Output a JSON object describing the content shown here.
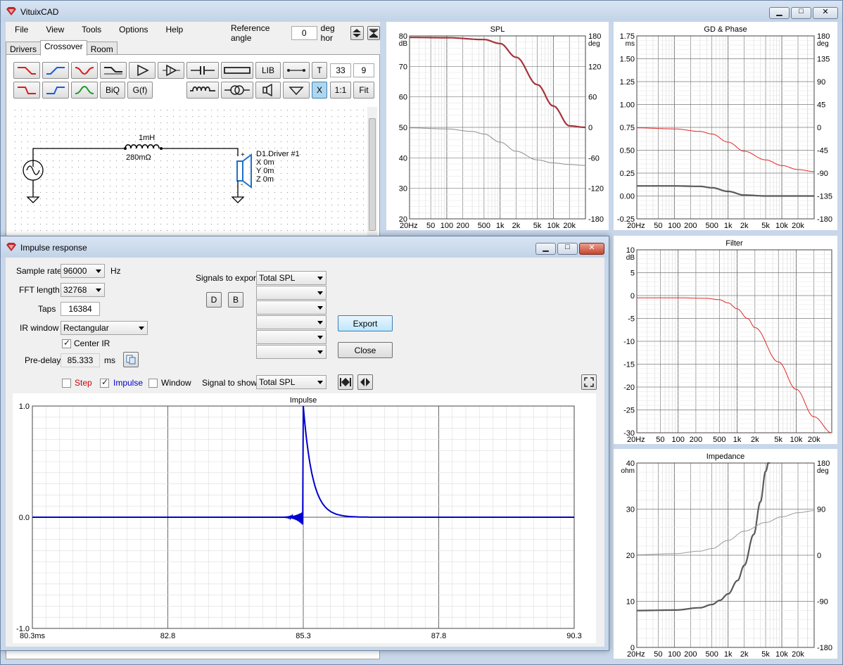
{
  "app": {
    "title": "VituixCAD",
    "menu": [
      "File",
      "View",
      "Tools",
      "Options",
      "Help"
    ],
    "reference_angle_label": "Reference angle",
    "reference_angle_value": "0",
    "reference_angle_unit": "deg hor",
    "tabs": [
      "Drivers",
      "Crossover",
      "Room"
    ],
    "active_tab": "Crossover"
  },
  "toolbar": {
    "lib": "LIB",
    "biq": "BiQ",
    "gf": "G(f)",
    "t": "T",
    "x": "X",
    "grid_a": "33",
    "grid_b": "9",
    "one_to_one": "1:1",
    "fit": "Fit"
  },
  "schematic": {
    "inductor_value": "1mH",
    "inductor_resistance": "280mΩ",
    "driver_name": "D1.Driver #1",
    "driver_x": "X 0m",
    "driver_y": "Y 0m",
    "driver_z": "Z 0m",
    "plus": "+",
    "minus": "-"
  },
  "charts": {
    "spl": {
      "title": "SPL",
      "yunit": "dB",
      "y2unit": "deg",
      "yticks": [
        "80",
        "70",
        "60",
        "50",
        "40",
        "30",
        "20"
      ],
      "y2ticks": [
        "180",
        "120",
        "60",
        "0",
        "-60",
        "-120",
        "-180"
      ],
      "xticks": [
        "20Hz",
        "50",
        "100",
        "200",
        "500",
        "1k",
        "2k",
        "5k",
        "10k",
        "20k"
      ]
    },
    "gd": {
      "title": "GD & Phase",
      "yunit": "ms",
      "y2unit": "deg",
      "yticks": [
        "1.75",
        "1.50",
        "1.25",
        "1.00",
        "0.75",
        "0.50",
        "0.25",
        "0.00",
        "-0.25"
      ],
      "y2ticks": [
        "180",
        "135",
        "90",
        "45",
        "0",
        "-45",
        "-90",
        "-135",
        "-180"
      ],
      "xticks": [
        "20Hz",
        "50",
        "100",
        "200",
        "500",
        "1k",
        "2k",
        "5k",
        "10k",
        "20k"
      ]
    },
    "filter": {
      "title": "Filter",
      "yunit": "dB",
      "yticks": [
        "10",
        "5",
        "0",
        "-5",
        "-10",
        "-15",
        "-20",
        "-25",
        "-30"
      ],
      "xticks": [
        "20Hz",
        "50",
        "100",
        "200",
        "500",
        "1k",
        "2k",
        "5k",
        "10k",
        "20k"
      ]
    },
    "impedance": {
      "title": "Impedance",
      "yunit": "ohm",
      "y2unit": "deg",
      "yticks": [
        "40",
        "30",
        "20",
        "10",
        "0"
      ],
      "y2ticks": [
        "180",
        "90",
        "0",
        "-90",
        "-180"
      ],
      "xticks": [
        "20Hz",
        "50",
        "100",
        "200",
        "500",
        "1k",
        "2k",
        "5k",
        "10k",
        "20k"
      ]
    }
  },
  "impulse_dialog": {
    "title": "Impulse response",
    "sample_rate_label": "Sample rate",
    "sample_rate": "96000",
    "sample_rate_unit": "Hz",
    "fft_label": "FFT length",
    "fft": "32768",
    "taps_label": "Taps",
    "taps": "16384",
    "ir_window_label": "IR window",
    "ir_window": "Rectangular",
    "center_ir": "Center IR",
    "predelay_label": "Pre-delay",
    "predelay": "85.333",
    "predelay_unit": "ms",
    "signals_export_label": "Signals to export",
    "signal_export_1": "Total SPL",
    "d_btn": "D",
    "b_btn": "B",
    "export_btn": "Export",
    "close_btn": "Close",
    "step": "Step",
    "impulse": "Impulse",
    "window": "Window",
    "signal_show_label": "Signal to show",
    "signal_show": "Total SPL",
    "chart_title": "Impulse",
    "yticks": [
      "1.0",
      "0.0",
      "-1.0"
    ],
    "xticks": [
      "80.3ms",
      "82.8",
      "85.3",
      "87.8",
      "90.3"
    ]
  },
  "chart_data": [
    {
      "type": "line",
      "title": "SPL",
      "ylabel": "dB",
      "ylim": [
        20,
        80
      ],
      "y2lim": [
        -180,
        180
      ],
      "xscale": "log",
      "xlim": [
        20,
        40000
      ],
      "series": [
        {
          "x": [
            20,
            100,
            500,
            1000,
            2000,
            5000,
            10000,
            20000,
            40000
          ],
          "values": [
            79.5,
            79.4,
            78.8,
            77.5,
            73,
            64,
            57,
            50.5,
            50
          ],
          "color": "#a4343a"
        },
        {
          "x": [
            20,
            100,
            300,
            500,
            1000,
            2000,
            5000,
            10000,
            20000,
            40000
          ],
          "values": [
            -1,
            -3,
            -8,
            -13,
            -29,
            -47,
            -64,
            -70,
            -73,
            -75
          ],
          "axis": "right",
          "color": "#8c8c8c"
        }
      ]
    },
    {
      "type": "line",
      "title": "GD & Phase",
      "ylabel": "ms",
      "ylim": [
        -0.25,
        1.75
      ],
      "y2lim": [
        -180,
        180
      ],
      "xscale": "log",
      "xlim": [
        20,
        40000
      ],
      "series": [
        {
          "x": [
            20,
            100,
            300,
            500,
            1000,
            2000,
            5000,
            10000,
            20000,
            40000
          ],
          "values": [
            0.11,
            0.11,
            0.105,
            0.09,
            0.05,
            0.01,
            0,
            0,
            0,
            0
          ],
          "color": "#5a5a5a"
        },
        {
          "x": [
            20,
            100,
            300,
            500,
            1000,
            2000,
            5000,
            10000,
            20000,
            40000
          ],
          "values": [
            -1,
            -3,
            -8,
            -13,
            -29,
            -47,
            -64,
            -75,
            -83,
            -87
          ],
          "axis": "right",
          "color": "#e32626"
        }
      ]
    },
    {
      "type": "line",
      "title": "Filter",
      "ylabel": "dB",
      "ylim": [
        -30,
        10
      ],
      "xscale": "log",
      "xlim": [
        20,
        40000
      ],
      "series": [
        {
          "x": [
            20,
            100,
            300,
            500,
            700,
            1000,
            1500,
            2000,
            5000,
            10000,
            20000,
            40000
          ],
          "values": [
            -0.5,
            -0.5,
            -0.6,
            -0.9,
            -1.6,
            -2.9,
            -5,
            -7,
            -14.5,
            -20.5,
            -26.5,
            -30
          ],
          "color": "#e32626"
        }
      ]
    },
    {
      "type": "line",
      "title": "Impedance",
      "ylabel": "ohm",
      "ylim": [
        0,
        40
      ],
      "y2lim": [
        -180,
        180
      ],
      "xscale": "log",
      "xlim": [
        20,
        40000
      ],
      "series": [
        {
          "x": [
            20,
            100,
            300,
            500,
            700,
            1000,
            1500,
            2000,
            3000,
            4000,
            5000,
            6000
          ],
          "values": [
            8,
            8.1,
            8.6,
            9.3,
            10.2,
            11.6,
            14.5,
            17.8,
            24.5,
            31.6,
            38.2,
            41.5
          ],
          "color": "#5a5a5a"
        },
        {
          "x": [
            20,
            100,
            300,
            500,
            1000,
            2000,
            5000,
            10000,
            20000,
            40000
          ],
          "values": [
            1,
            3,
            8,
            13,
            29,
            47,
            64,
            75,
            83,
            87
          ],
          "axis": "right",
          "color": "#9a9a9a"
        }
      ]
    },
    {
      "type": "line",
      "title": "Impulse",
      "ylim": [
        -1,
        1
      ],
      "xlim": [
        80.3,
        90.3
      ],
      "series": [
        {
          "name": "Impulse",
          "color": "#0000d0",
          "x": [
            80.3,
            85.2,
            85.3,
            85.45,
            85.6,
            85.8,
            86.2,
            90.3
          ],
          "values": [
            0,
            0,
            1,
            0.43,
            0.2,
            0.08,
            0.01,
            0
          ]
        }
      ]
    }
  ]
}
